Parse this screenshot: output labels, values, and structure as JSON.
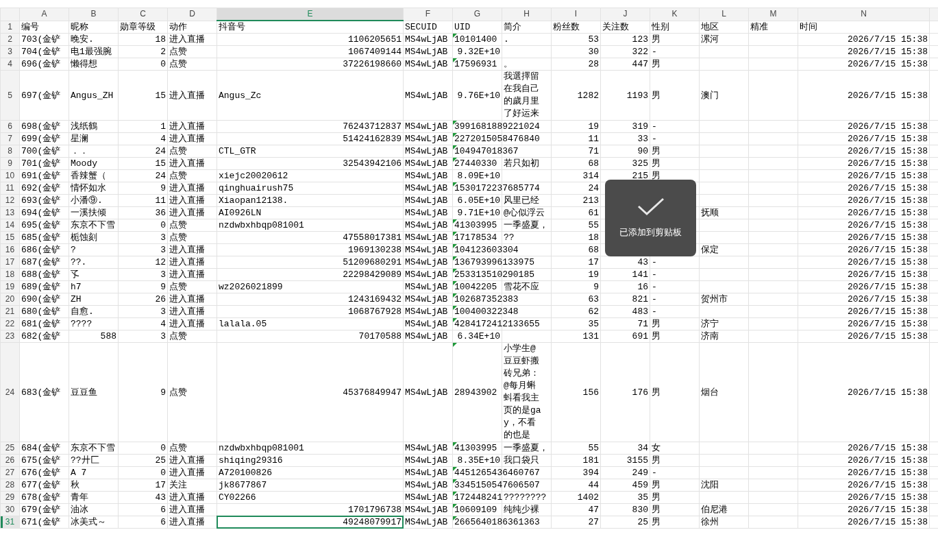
{
  "columns": [
    {
      "letter": "A",
      "selected": false
    },
    {
      "letter": "B",
      "selected": false
    },
    {
      "letter": "C",
      "selected": false
    },
    {
      "letter": "D",
      "selected": false
    },
    {
      "letter": "E",
      "selected": true
    },
    {
      "letter": "F",
      "selected": false
    },
    {
      "letter": "G",
      "selected": false
    },
    {
      "letter": "H",
      "selected": false
    },
    {
      "letter": "I",
      "selected": false
    },
    {
      "letter": "J",
      "selected": false
    },
    {
      "letter": "K",
      "selected": false
    },
    {
      "letter": "L",
      "selected": false
    },
    {
      "letter": "M",
      "selected": false
    },
    {
      "letter": "N",
      "selected": false
    }
  ],
  "rows": [
    {
      "num": "1",
      "selected": false,
      "marker": false,
      "cells": {
        "A": "编号",
        "B": "昵称",
        "C": "勋章等级",
        "D": "动作",
        "E": "抖音号",
        "F": "SECUID",
        "G": "UID",
        "H": "简介",
        "I": "粉丝数",
        "J": "关注数",
        "K": "性别",
        "L": "地区",
        "M": "精准",
        "N": "时间"
      }
    },
    {
      "num": "2",
      "selected": false,
      "marker": true,
      "cells": {
        "A": "703(金铲",
        "B": "晚安.",
        "C": {
          "text": "18",
          "kind": "number"
        },
        "D": "进入直播",
        "E": {
          "text": "1106205651",
          "kind": "number"
        },
        "F": "MS4wLjAB",
        "G": "10101400",
        "H": ".",
        "I": {
          "text": "53",
          "kind": "number"
        },
        "J": {
          "text": "123",
          "kind": "number"
        },
        "K": "男",
        "L": "漯河",
        "N": {
          "text": "2026/7/15 15:38",
          "kind": "number"
        }
      }
    },
    {
      "num": "3",
      "selected": false,
      "marker": false,
      "cells": {
        "A": "704(金铲",
        "B": "电1最强腕",
        "C": {
          "text": "2",
          "kind": "number"
        },
        "D": "点赞",
        "E": {
          "text": "1067409144",
          "kind": "number"
        },
        "F": "MS4wLjAB",
        "G": {
          "text": "9.32E+10",
          "kind": "number"
        },
        "I": {
          "text": "30",
          "kind": "number"
        },
        "J": {
          "text": "322",
          "kind": "number"
        },
        "K": "-",
        "N": {
          "text": "2026/7/15 15:38",
          "kind": "number"
        }
      }
    },
    {
      "num": "4",
      "selected": false,
      "marker": true,
      "cells": {
        "A": "696(金铲",
        "B": "懒得想",
        "C": {
          "text": "0",
          "kind": "number"
        },
        "D": "点赞",
        "E": {
          "text": "37226198660",
          "kind": "number"
        },
        "F": "MS4wLjAB",
        "G": "17596931",
        "H": "。",
        "I": {
          "text": "28",
          "kind": "number"
        },
        "J": {
          "text": "447",
          "kind": "number"
        },
        "K": "男",
        "N": {
          "text": "2026/7/15 15:38",
          "kind": "number"
        }
      }
    },
    {
      "num": "5",
      "selected": false,
      "marker": false,
      "cells": {
        "A": "697(金铲",
        "B": "Angus_ZH",
        "C": {
          "text": "15",
          "kind": "number"
        },
        "D": "进入直播",
        "E": "Angus_Zc",
        "F": "MS4wLjAB",
        "G": {
          "text": "9.76E+10",
          "kind": "number"
        },
        "H": {
          "text": "我選擇留在我自己的歲月里了好运来",
          "kind": "wrap"
        },
        "I": {
          "text": "1282",
          "kind": "number"
        },
        "J": {
          "text": "1193",
          "kind": "number"
        },
        "K": "男",
        "L": "澳门",
        "N": {
          "text": "2026/7/15 15:38",
          "kind": "number"
        }
      }
    },
    {
      "num": "6",
      "selected": false,
      "marker": true,
      "cells": {
        "A": "698(金铲",
        "B": "浅纸鶴",
        "C": {
          "text": "1",
          "kind": "number"
        },
        "D": "进入直播",
        "E": {
          "text": "76243712837",
          "kind": "number"
        },
        "F": "MS4wLjAB",
        "G": "3991681889221024",
        "I": {
          "text": "19",
          "kind": "number"
        },
        "J": {
          "text": "319",
          "kind": "number"
        },
        "K": "-",
        "N": {
          "text": "2026/7/15 15:38",
          "kind": "number"
        }
      }
    },
    {
      "num": "7",
      "selected": false,
      "marker": true,
      "cells": {
        "A": "699(金铲",
        "B": "星澜",
        "C": {
          "text": "4",
          "kind": "number"
        },
        "D": "进入直播",
        "E": {
          "text": "51424162839",
          "kind": "number"
        },
        "F": "MS4wLjAB",
        "G": "2272015058476840",
        "I": {
          "text": "11",
          "kind": "number"
        },
        "J": {
          "text": "33",
          "kind": "number"
        },
        "K": "-",
        "N": {
          "text": "2026/7/15 15:38",
          "kind": "number"
        }
      }
    },
    {
      "num": "8",
      "selected": false,
      "marker": true,
      "cells": {
        "A": "700(金铲",
        "B": "．．",
        "C": {
          "text": "24",
          "kind": "number"
        },
        "D": "点赞",
        "E": "CTL_GTR",
        "F": "MS4wLjAB",
        "G": "104947018367",
        "I": {
          "text": "71",
          "kind": "number"
        },
        "J": {
          "text": "90",
          "kind": "number"
        },
        "K": "男",
        "N": {
          "text": "2026/7/15 15:38",
          "kind": "number"
        }
      }
    },
    {
      "num": "9",
      "selected": false,
      "marker": true,
      "cells": {
        "A": "701(金铲",
        "B": "Moody",
        "C": {
          "text": "15",
          "kind": "number"
        },
        "D": "进入直播",
        "E": {
          "text": "32543942106",
          "kind": "number"
        },
        "F": "MS4wLjAB",
        "G": "27440330",
        "H": "若只如初",
        "I": {
          "text": "68",
          "kind": "number"
        },
        "J": {
          "text": "325",
          "kind": "number"
        },
        "K": "男",
        "N": {
          "text": "2026/7/15 15:38",
          "kind": "number"
        }
      }
    },
    {
      "num": "10",
      "selected": false,
      "marker": false,
      "cells": {
        "A": "691(金铲",
        "B": "香辣蟹（",
        "C": {
          "text": "24",
          "kind": "number"
        },
        "D": "点赞",
        "E": "xiejc20020612",
        "F": "MS4wLjAB",
        "G": {
          "text": "8.09E+10",
          "kind": "number"
        },
        "I": {
          "text": "314",
          "kind": "number"
        },
        "J": {
          "text": "215",
          "kind": "number"
        },
        "K": "男",
        "N": {
          "text": "2026/7/15 15:38",
          "kind": "number"
        }
      }
    },
    {
      "num": "11",
      "selected": false,
      "marker": true,
      "cells": {
        "A": "692(金铲",
        "B": "情怀如水",
        "C": {
          "text": "9",
          "kind": "number"
        },
        "D": "进入直播",
        "E": "qinghuairush75",
        "F": "MS4wLjAB",
        "G": "1530172237685774",
        "I": {
          "text": "24",
          "kind": "number"
        },
        "N": {
          "text": "2026/7/15 15:38",
          "kind": "number"
        }
      }
    },
    {
      "num": "12",
      "selected": false,
      "marker": false,
      "cells": {
        "A": "693(金铲",
        "B": "小潘⑨.",
        "C": {
          "text": "11",
          "kind": "number"
        },
        "D": "进入直播",
        "E": "Xiaopan12138.",
        "F": "MS4wLjAB",
        "G": {
          "text": "6.05E+10",
          "kind": "number"
        },
        "H": "风里已经",
        "I": {
          "text": "213",
          "kind": "number"
        },
        "N": {
          "text": "2026/7/15 15:38",
          "kind": "number"
        }
      }
    },
    {
      "num": "13",
      "selected": false,
      "marker": false,
      "cells": {
        "A": "694(金铲",
        "B": "一溪扶倾",
        "C": {
          "text": "36",
          "kind": "number"
        },
        "D": "进入直播",
        "E": "AI0926LN",
        "F": "MS4wLjAB",
        "G": {
          "text": "9.71E+10",
          "kind": "number"
        },
        "H": "@心似浮云",
        "I": {
          "text": "61",
          "kind": "number"
        },
        "L": "抚顺",
        "N": {
          "text": "2026/7/15 15:38",
          "kind": "number"
        }
      }
    },
    {
      "num": "14",
      "selected": false,
      "marker": true,
      "cells": {
        "A": "695(金铲",
        "B": "东京不下雪",
        "C": {
          "text": "0",
          "kind": "number"
        },
        "D": "点赞",
        "E": "nzdwbxhbqp081001",
        "F": "MS4wLjAB",
        "G": "41303995",
        "H": "一季盛夏，",
        "I": {
          "text": "55",
          "kind": "number"
        },
        "N": {
          "text": "2026/7/15 15:38",
          "kind": "number"
        }
      }
    },
    {
      "num": "15",
      "selected": false,
      "marker": true,
      "cells": {
        "A": "685(金铲",
        "B": "栀蚀刻",
        "C": {
          "text": "3",
          "kind": "number"
        },
        "D": "点赞",
        "E": {
          "text": "47558017381",
          "kind": "number"
        },
        "F": "MS4wLjAB",
        "G": "17178534",
        "H": "??",
        "I": {
          "text": "18",
          "kind": "number"
        },
        "N": {
          "text": "2026/7/15 15:38",
          "kind": "number"
        }
      }
    },
    {
      "num": "16",
      "selected": false,
      "marker": true,
      "cells": {
        "A": "686(金铲",
        "B": "?",
        "C": {
          "text": "3",
          "kind": "number"
        },
        "D": "进入直播",
        "E": {
          "text": "1969130238",
          "kind": "number"
        },
        "F": "MS4wLjAB",
        "G": "104123603304",
        "I": {
          "text": "68",
          "kind": "number"
        },
        "L": "保定",
        "N": {
          "text": "2026/7/15 15:38",
          "kind": "number"
        }
      }
    },
    {
      "num": "17",
      "selected": false,
      "marker": true,
      "cells": {
        "A": "687(金铲",
        "B": "??.",
        "C": {
          "text": "12",
          "kind": "number"
        },
        "D": "进入直播",
        "E": {
          "text": "51209680291",
          "kind": "number"
        },
        "F": "MS4wLjAB",
        "G": "136793996133975",
        "I": {
          "text": "17",
          "kind": "number"
        },
        "J": {
          "text": "43",
          "kind": "number"
        },
        "K": "-",
        "N": {
          "text": "2026/7/15 15:38",
          "kind": "number"
        }
      }
    },
    {
      "num": "18",
      "selected": false,
      "marker": true,
      "cells": {
        "A": "688(金铲",
        "B": "孓",
        "C": {
          "text": "3",
          "kind": "number"
        },
        "D": "进入直播",
        "E": {
          "text": "22298429089",
          "kind": "number"
        },
        "F": "MS4wLjAB",
        "G": "253313510290185",
        "I": {
          "text": "19",
          "kind": "number"
        },
        "J": {
          "text": "141",
          "kind": "number"
        },
        "K": "-",
        "N": {
          "text": "2026/7/15 15:38",
          "kind": "number"
        }
      }
    },
    {
      "num": "19",
      "selected": false,
      "marker": true,
      "cells": {
        "A": "689(金铲",
        "B": "h7",
        "C": {
          "text": "9",
          "kind": "number"
        },
        "D": "点赞",
        "E": "wz2026021899",
        "F": "MS4wLjAB",
        "G": "10042205",
        "H": "雪花不应",
        "I": {
          "text": "9",
          "kind": "number"
        },
        "J": {
          "text": "16",
          "kind": "number"
        },
        "K": "-",
        "N": {
          "text": "2026/7/15 15:38",
          "kind": "number"
        }
      }
    },
    {
      "num": "20",
      "selected": false,
      "marker": true,
      "cells": {
        "A": "690(金铲",
        "B": "ZH",
        "C": {
          "text": "26",
          "kind": "number"
        },
        "D": "进入直播",
        "E": {
          "text": "1243169432",
          "kind": "number"
        },
        "F": "MS4wLjAB",
        "G": "102687352383",
        "I": {
          "text": "63",
          "kind": "number"
        },
        "J": {
          "text": "821",
          "kind": "number"
        },
        "K": "-",
        "L": "贺州市",
        "N": {
          "text": "2026/7/15 15:38",
          "kind": "number"
        }
      }
    },
    {
      "num": "21",
      "selected": false,
      "marker": true,
      "cells": {
        "A": "680(金铲",
        "B": "自愈.",
        "C": {
          "text": "3",
          "kind": "number"
        },
        "D": "进入直播",
        "E": {
          "text": "1068767928",
          "kind": "number"
        },
        "F": "MS4wLjAB",
        "G": "100400322348",
        "I": {
          "text": "62",
          "kind": "number"
        },
        "J": {
          "text": "483",
          "kind": "number"
        },
        "K": "-",
        "N": {
          "text": "2026/7/15 15:38",
          "kind": "number"
        }
      }
    },
    {
      "num": "22",
      "selected": false,
      "marker": true,
      "cells": {
        "A": "681(金铲",
        "B": "????",
        "C": {
          "text": "4",
          "kind": "number"
        },
        "D": "进入直播",
        "E": "lalala.05",
        "F": "MS4wLjAB",
        "G": "4284172412133655",
        "I": {
          "text": "35",
          "kind": "number"
        },
        "J": {
          "text": "71",
          "kind": "number"
        },
        "K": "男",
        "L": "济宁",
        "N": {
          "text": "2026/7/15 15:38",
          "kind": "number"
        }
      }
    },
    {
      "num": "23",
      "selected": false,
      "marker": false,
      "cells": {
        "A": "682(金铲",
        "B": {
          "text": "588",
          "kind": "number"
        },
        "C": {
          "text": "3",
          "kind": "number"
        },
        "D": "点赞",
        "E": {
          "text": "70170588",
          "kind": "number"
        },
        "F": "MS4wLjAB",
        "G": {
          "text": "6.34E+10",
          "kind": "number"
        },
        "I": {
          "text": "131",
          "kind": "number"
        },
        "J": {
          "text": "691",
          "kind": "number"
        },
        "K": "男",
        "L": "济南",
        "N": {
          "text": "2026/7/15 15:38",
          "kind": "number"
        }
      }
    },
    {
      "num": "24",
      "selected": false,
      "marker": true,
      "cells": {
        "A": "683(金铲",
        "B": "豆豆鱼",
        "C": {
          "text": "9",
          "kind": "number"
        },
        "D": "点赞",
        "E": {
          "text": "45376849947",
          "kind": "number"
        },
        "F": "MS4wLjAB",
        "G": "28943902",
        "H": {
          "text": "小学生@豆豆虾搬砖兄弟：@每月蝌蚪看我主页的是gay，不看的也是",
          "kind": "wrap"
        },
        "I": {
          "text": "156",
          "kind": "number"
        },
        "J": {
          "text": "176",
          "kind": "number"
        },
        "K": "男",
        "L": "烟台",
        "N": {
          "text": "2026/7/15 15:38",
          "kind": "number"
        }
      }
    },
    {
      "num": "25",
      "selected": false,
      "marker": true,
      "cells": {
        "A": "684(金铲",
        "B": "东京不下雪",
        "C": {
          "text": "0",
          "kind": "number"
        },
        "D": "点赞",
        "E": "nzdwbxhbqp081001",
        "F": "MS4wLjAB",
        "G": "41303995",
        "H": "一季盛夏，",
        "I": {
          "text": "55",
          "kind": "number"
        },
        "J": {
          "text": "34",
          "kind": "number"
        },
        "K": "女",
        "N": {
          "text": "2026/7/15 15:38",
          "kind": "number"
        }
      }
    },
    {
      "num": "26",
      "selected": false,
      "marker": false,
      "cells": {
        "A": "675(金铲",
        "B": "??廾匚",
        "C": {
          "text": "25",
          "kind": "number"
        },
        "D": "进入直播",
        "E": "shiqing29316",
        "F": "MS4wLjAB",
        "G": {
          "text": "8.35E+10",
          "kind": "number"
        },
        "H": "我口袋只",
        "I": {
          "text": "181",
          "kind": "number"
        },
        "J": {
          "text": "3155",
          "kind": "number"
        },
        "K": "男",
        "N": {
          "text": "2026/7/15 15:38",
          "kind": "number"
        }
      }
    },
    {
      "num": "27",
      "selected": false,
      "marker": true,
      "cells": {
        "A": "676(金铲",
        "B": "A 7",
        "C": {
          "text": "0",
          "kind": "number"
        },
        "D": "进入直播",
        "E": "A720100826",
        "F": "MS4wLjAB",
        "G": "4451265436460767",
        "I": {
          "text": "394",
          "kind": "number"
        },
        "J": {
          "text": "249",
          "kind": "number"
        },
        "K": "-",
        "N": {
          "text": "2026/7/15 15:38",
          "kind": "number"
        }
      }
    },
    {
      "num": "28",
      "selected": false,
      "marker": true,
      "cells": {
        "A": "677(金铲",
        "B": "秋",
        "C": {
          "text": "17",
          "kind": "number"
        },
        "D": "关注",
        "E": "jk8677867",
        "F": "MS4wLjAB",
        "G": "3345150547606507",
        "I": {
          "text": "44",
          "kind": "number"
        },
        "J": {
          "text": "459",
          "kind": "number"
        },
        "K": "男",
        "L": "沈阳",
        "N": {
          "text": "2026/7/15 15:38",
          "kind": "number"
        }
      }
    },
    {
      "num": "29",
      "selected": false,
      "marker": true,
      "cells": {
        "A": "678(金铲",
        "B": "青年",
        "C": {
          "text": "43",
          "kind": "number"
        },
        "D": "进入直播",
        "E": "CY02266",
        "F": "MS4wLjAB",
        "G": "172448241",
        "H": "????????",
        "I": {
          "text": "1402",
          "kind": "number"
        },
        "J": {
          "text": "35",
          "kind": "number"
        },
        "K": "男",
        "N": {
          "text": "2026/7/15 15:38",
          "kind": "number"
        }
      }
    },
    {
      "num": "30",
      "selected": false,
      "marker": true,
      "cells": {
        "A": "679(金铲",
        "B": "油冰",
        "C": {
          "text": "6",
          "kind": "number"
        },
        "D": "进入直播",
        "E": {
          "text": "1701796738",
          "kind": "number"
        },
        "F": "MS4wLjAB",
        "G": "10609109",
        "H": "纯纯少裸",
        "I": {
          "text": "47",
          "kind": "number"
        },
        "J": {
          "text": "830",
          "kind": "number"
        },
        "K": "男",
        "L": "伯尼港",
        "N": {
          "text": "2026/7/15 15:38",
          "kind": "number"
        }
      }
    },
    {
      "num": "31",
      "selected": true,
      "marker": true,
      "cells": {
        "A": "671(金铲",
        "B": "冰美式～",
        "C": {
          "text": "6",
          "kind": "number"
        },
        "D": "进入直播",
        "E": {
          "text": "49248079917",
          "kind": "number"
        },
        "F": "MS4wLjAB",
        "G": "2665640186361363",
        "I": {
          "text": "27",
          "kind": "number"
        },
        "J": {
          "text": "25",
          "kind": "number"
        },
        "K": "男",
        "L": "徐州",
        "N": {
          "text": "2026/7/15 15:38",
          "kind": "number"
        }
      }
    }
  ],
  "toast": {
    "message": "已添加到剪贴板"
  }
}
